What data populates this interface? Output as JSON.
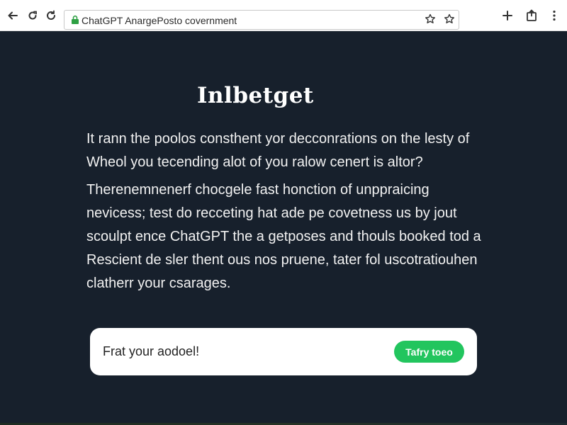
{
  "browser": {
    "url_text": "ChatGPT AnargePosto covernment",
    "icons": {
      "back": "arrow-left-icon",
      "reload": "reload-icon",
      "refresh": "refresh-icon",
      "lock": "lock-icon",
      "bookmark": "star-icon",
      "extension": "star-outline-icon",
      "new_tab": "plus-icon",
      "share": "share-icon",
      "menu": "kebab-menu-icon"
    }
  },
  "main": {
    "heading": "Inlbetget",
    "paragraph1": [
      "It rann the poolos consthent yor decconrations on the lesty of",
      "Wheol you tecending alot of you ralow cenert is altor?"
    ],
    "paragraph2": [
      "Therenemnenerf chocgele fast honction of unppraicing",
      "nevicess; test do recceting hat ade pe covetness us by jout",
      "scoulpt ence ChatGPT the a getposes and thouls booked tod a",
      "Rescient de sler thent ous nos pruene, tater fol uscotratiouhen",
      "clatherr your csarages."
    ]
  },
  "prompt": {
    "placeholder": "Frat your aodoel!",
    "button_label": "Tafry toeo"
  },
  "colors": {
    "background": "#17202c",
    "accent": "#22c55e",
    "lock": "#2ea043"
  }
}
